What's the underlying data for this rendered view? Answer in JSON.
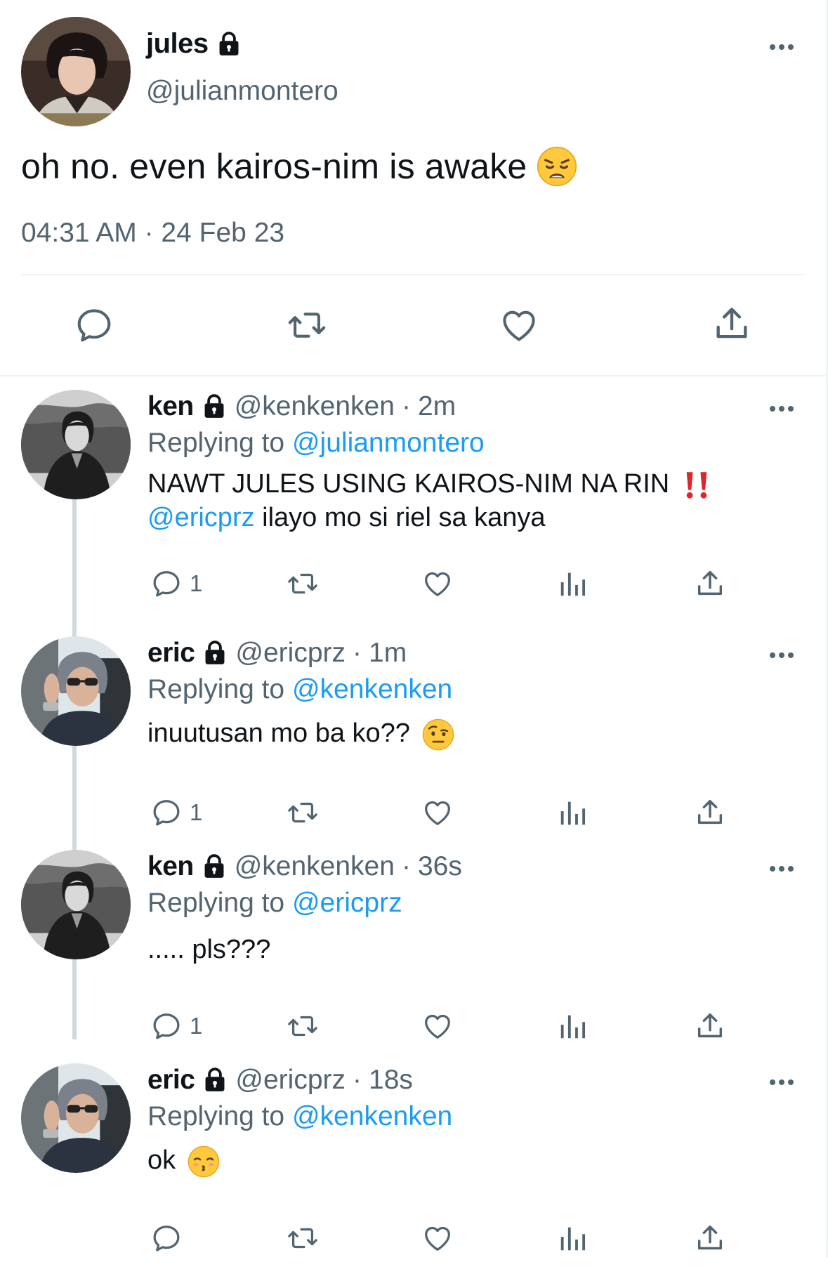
{
  "main_tweet": {
    "display_name": "jules",
    "handle": "@julianmontero",
    "text": "oh no. even kairos-nim is awake",
    "emoji": "weary-face",
    "timestamp": "04:31 AM · 24 Feb 23"
  },
  "replies": [
    {
      "display_name": "ken",
      "handle": "@kenkenken",
      "dot": "·",
      "time": "2m",
      "replying_prefix": "Replying to",
      "replying_to": "@julianmontero",
      "line1": "NAWT JULES USING KAIROS-NIM NA RIN",
      "line1_emoji": "double-exclamation",
      "line2_mention": "@ericprz",
      "line2_text": " ilayo mo si riel sa kanya",
      "reply_count": "1"
    },
    {
      "display_name": "eric",
      "handle": "@ericprz",
      "dot": "·",
      "time": "1m",
      "replying_prefix": "Replying to",
      "replying_to": "@kenkenken",
      "text": "inuutusan mo ba ko??",
      "emoji": "face-with-raised-eyebrow",
      "reply_count": "1"
    },
    {
      "display_name": "ken",
      "handle": "@kenkenken",
      "dot": "·",
      "time": "36s",
      "replying_prefix": "Replying to",
      "replying_to": "@ericprz",
      "text": "..... pls???",
      "reply_count": "1"
    },
    {
      "display_name": "eric",
      "handle": "@ericprz",
      "dot": "·",
      "time": "18s",
      "replying_prefix": "Replying to",
      "replying_to": "@kenkenken",
      "text": "ok",
      "emoji": "kissing-face",
      "reply_count": ""
    }
  ],
  "colors": {
    "link": "#1d9bf0",
    "muted": "#536471",
    "divider": "#eff3f4",
    "thread_line": "#cfd9de",
    "exclamation": "#e0242a"
  }
}
